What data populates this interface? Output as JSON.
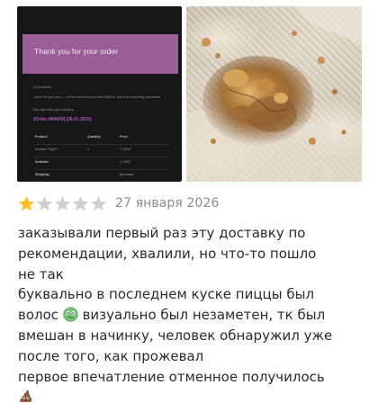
{
  "review": {
    "photos": [
      {
        "name": "order-confirmation-screenshot",
        "banner_title": "Thank you for your order",
        "greeting": "Hi Anastasia,",
        "intro": "Just to let you know — we've received your order #84430, and it is now being processed:",
        "pay_note": "Pay with cash upon delivery.",
        "order_heading": "[Order #84430] (26.01.2026)",
        "table": {
          "headers": [
            "Product",
            "Quantity",
            "Price"
          ],
          "rows": [
            [
              "Kuusiku \"ЕДАТ\"",
              "1",
              "1 749 ₽"
            ],
            [
              "Subtotal:",
              "",
              "1 749 ₽"
            ],
            [
              "Shipping:",
              "",
              "Доставка"
            ]
          ]
        },
        "colors": {
          "background": "#17171a",
          "banner": "#9a5d96",
          "accent": "#b05fac"
        }
      },
      {
        "name": "pizza-with-hair-photo"
      }
    ],
    "rating": {
      "value": 1,
      "max": 5,
      "filled_color": "#ffbd1f",
      "empty_color": "#cfcfcf"
    },
    "date": "27 января 2026",
    "text_lines": [
      "заказывали первый раз эту доставку по",
      "рекомендации, хвалили, но что-то пошло",
      "не так",
      "буквально в последнем куске пиццы был",
      "визуально был незаметен, тк был",
      "вмешан в начинку, человек обнаружил уже",
      "после того, как прожевал",
      "первое впечатление отменное получилось"
    ],
    "inline_line_prefix": "волос",
    "emojis": [
      "nauseated-face-emoji",
      "pile-of-poo-emoji"
    ]
  }
}
